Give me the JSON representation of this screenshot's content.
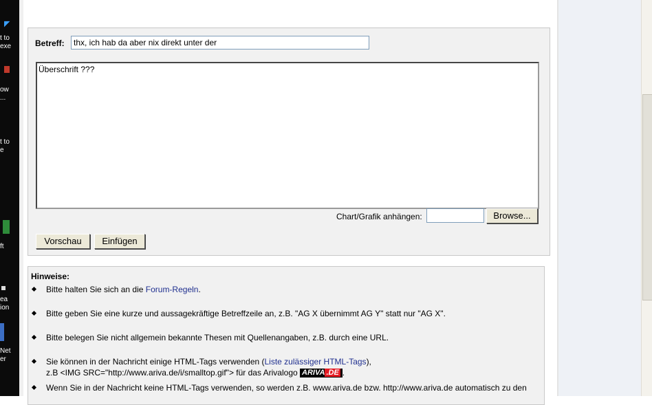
{
  "desktop": {
    "labels": [
      "t to",
      "exe",
      "ow",
      "...",
      "t to",
      "e",
      "ft",
      "ea",
      "ion",
      "Net",
      "er"
    ]
  },
  "form": {
    "subject_label": "Betreff:",
    "subject_value": "thx, ich hab da aber nix direkt unter der",
    "message_value": "Überschrift ???",
    "attach_label": "Chart/Grafik anhängen:",
    "browse_label": "Browse...",
    "preview_label": "Vorschau",
    "insert_label": "Einfügen"
  },
  "hints": {
    "title": "Hinweise:",
    "h1_prefix": "Bitte halten Sie sich an die ",
    "h1_link": "Forum-Regeln",
    "h1_suffix": ".",
    "h2": "Bitte geben Sie eine kurze und aussagekräftige Betreffzeile an, z.B. \"AG X übernimmt AG Y\" statt nur \"AG X\".",
    "h3": "Bitte belegen Sie nicht allgemein bekannte Thesen mit Quellenangaben, z.B. durch eine URL.",
    "h4_prefix": "Sie können in der Nachricht einige HTML-Tags verwenden (",
    "h4_link": "Liste zulässiger HTML-Tags",
    "h4_suffix": "),",
    "h4_line2": "z.B <IMG SRC=\"http://www.ariva.de/i/smalltop.gif\"> für das Arivalogo",
    "logo_main": "ARIVA",
    "logo_de": ".DE",
    "h4_line2_suffix": ".",
    "h5": "Wenn Sie in der Nachricht keine HTML-Tags verwenden, so werden z.B. www.ariva.de bzw. http://www.ariva.de automatisch zu den"
  },
  "colors": {
    "link": "#1f2f8f",
    "panel": "#f1f1f1",
    "logo_red": "#e31b23"
  }
}
